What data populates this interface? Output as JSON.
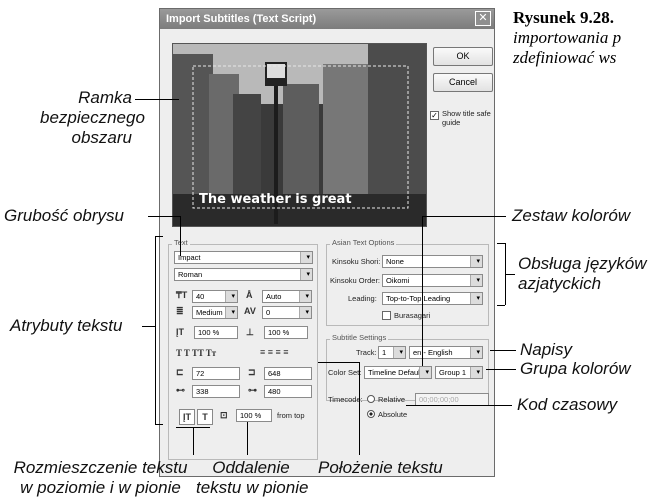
{
  "caption": {
    "line1_bold": "Rysunek 9.28.",
    "line2": "importowania p",
    "line3": "zdefiniować ws"
  },
  "dialog": {
    "title": "Import Subtitles (Text Script)",
    "close_glyph": "✕",
    "ok_label": "OK",
    "cancel_label": "Cancel",
    "safe_guide_label": "Show title safe guide",
    "safe_guide_checked": "✓",
    "preview_text": "The weather is great"
  },
  "text_group": {
    "label": "Text",
    "font": "Impact",
    "style": "Roman",
    "size": "40",
    "leading": "Auto",
    "stroke": "Medium",
    "tracking": "0",
    "vscale": "100 %",
    "hscale": "100 %",
    "format_icons": "T  T   TT  Tт",
    "x": "72",
    "y": "648",
    "width": "338",
    "height": "480",
    "offset": "100 %",
    "offset_from": "from top"
  },
  "asian_group": {
    "label": "Asian Text Options",
    "kinsoku_shori_label": "Kinsoku Shori:",
    "kinsoku_shori_value": "None",
    "kinsoku_order_label": "Kinsoku Order:",
    "kinsoku_order_value": "Oikomi",
    "leading_label": "Leading:",
    "leading_value": "Top-to-Top Leading",
    "burasagari_label": "Burasagari"
  },
  "subtitle_group": {
    "label": "Subtitle Settings",
    "track_label": "Track:",
    "track_value": "1",
    "language_value": "en - English",
    "colorset_label": "Color Set:",
    "colorset_value": "Timeline Default",
    "group_value": "Group 1",
    "timecode_label": "Timecode:",
    "relative_label": "Relative",
    "absolute_label": "Absolute",
    "timecode_value": "00;00;00;00"
  },
  "annotations": {
    "safe_frame": [
      "Ramka",
      "bezpiecznego",
      "obszaru"
    ],
    "stroke_width": "Grubość obrysu",
    "text_attrs": "Atrybuty tekstu",
    "color_set": "Zestaw kolorów",
    "asian_support": [
      "Obsługa języków",
      "azjatyckich"
    ],
    "subtitles": "Napisy",
    "color_group": "Grupa kolorów",
    "timecode": "Kod czasowy",
    "text_layout": [
      "Rozmieszczenie tekstu",
      "w poziomie i w pionie"
    ],
    "text_offset": [
      "Oddalenie",
      "tekstu w pionie"
    ],
    "text_position": "Położenie tekstu"
  }
}
